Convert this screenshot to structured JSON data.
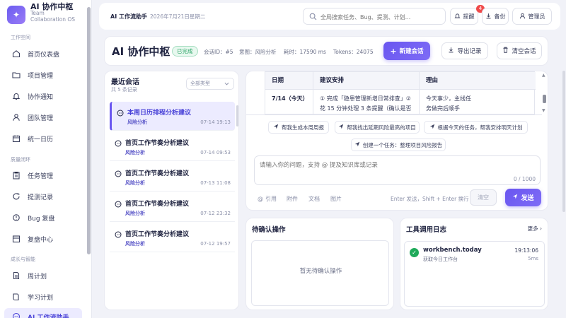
{
  "brand": {
    "title": "AI 协作中枢",
    "subtitle": "Team Collaboration OS"
  },
  "sidebar": {
    "sections": [
      {
        "label": "工作空间"
      },
      {
        "label": "质量闭环"
      },
      {
        "label": "成长与智能"
      }
    ],
    "items": [
      {
        "label": "首页仪表盘",
        "icon": "home-icon"
      },
      {
        "label": "项目管理",
        "icon": "folder-icon"
      },
      {
        "label": "协作通知",
        "icon": "bell-icon"
      },
      {
        "label": "团队管理",
        "icon": "team-icon"
      },
      {
        "label": "统一日历",
        "icon": "calendar-icon"
      },
      {
        "label": "任务管理",
        "icon": "clipboard-icon"
      },
      {
        "label": "提测记录",
        "icon": "refresh-icon"
      },
      {
        "label": "Bug 复盘",
        "icon": "bug-icon"
      },
      {
        "label": "复盘中心",
        "icon": "archive-icon"
      },
      {
        "label": "周计划",
        "icon": "document-icon"
      },
      {
        "label": "学习计划",
        "icon": "book-icon"
      },
      {
        "label": "AI 工作流助手",
        "icon": "chat-icon",
        "active": true
      }
    ]
  },
  "topbar": {
    "title": "AI 工作流助手",
    "date": "2026年7月21日星期二",
    "search_placeholder": "全局搜索任务、Bug、提测、计划...",
    "remind_label": "提醒",
    "remind_badge": "4",
    "backup_label": "备份",
    "admin_label": "管理员"
  },
  "header": {
    "title": "AI 协作中枢",
    "status": "已完成",
    "session_id": "会话ID：#5",
    "intent": "意图：风险分析",
    "duration": "耗时：17590 ms",
    "tokens": "Tokens：24075",
    "new_session": "新建会话",
    "export": "导出记录",
    "clear": "清空会话"
  },
  "recent": {
    "title": "最近会话",
    "count": "共 5 条记录",
    "filter": "全部类型",
    "conversations": [
      {
        "title": "本周日历排程分析建议",
        "tag": "风险分析",
        "time": "07-14 19:13",
        "active": true
      },
      {
        "title": "首页工作节奏分析建议",
        "tag": "风险分析",
        "time": "07-14 09:53"
      },
      {
        "title": "首页工作节奏分析建议",
        "tag": "风险分析",
        "time": "07-13 11:08"
      },
      {
        "title": "首页工作节奏分析建议",
        "tag": "风险分析",
        "time": "07-12 23:32"
      },
      {
        "title": "首页工作节奏分析建议",
        "tag": "风险分析",
        "time": "07-12 19:57"
      }
    ]
  },
  "chat": {
    "table": {
      "headers": [
        "日期",
        "建议安排",
        "理由"
      ],
      "row": [
        "7/14（今天）",
        "① 完成「隐患管理新增日常排查」② 花 15 分钟处理 3 条提醒（确认是否",
        "今天事少，主线任务做完后顺手"
      ]
    },
    "chips": [
      "帮我生成本周周报",
      "帮我找出延期风险最高的项目",
      "根据今天的任务，帮我安排明天计划",
      "创建一个任务：整理项目风险报告"
    ],
    "input_placeholder": "请输入你的问题，支持 @ 提及知识库或记录",
    "char_count": "0 / 1000",
    "tools": [
      "引用",
      "附件",
      "文档",
      "图片"
    ],
    "hint": "Enter 发送，Shift + Enter 换行",
    "clear_label": "清空",
    "send_label": "发送"
  },
  "pending": {
    "title": "待确认操作",
    "empty": "暂无待确认操作"
  },
  "toollog": {
    "title": "工具调用日志",
    "more": "更多",
    "entries": [
      {
        "name": "workbench.today",
        "desc": "获取今日工作台",
        "time": "19:13:06",
        "duration": "5ms"
      }
    ]
  },
  "colors": {
    "accent": "#6a56f0",
    "success": "#1faa5a",
    "badge": "#f04a4a"
  }
}
